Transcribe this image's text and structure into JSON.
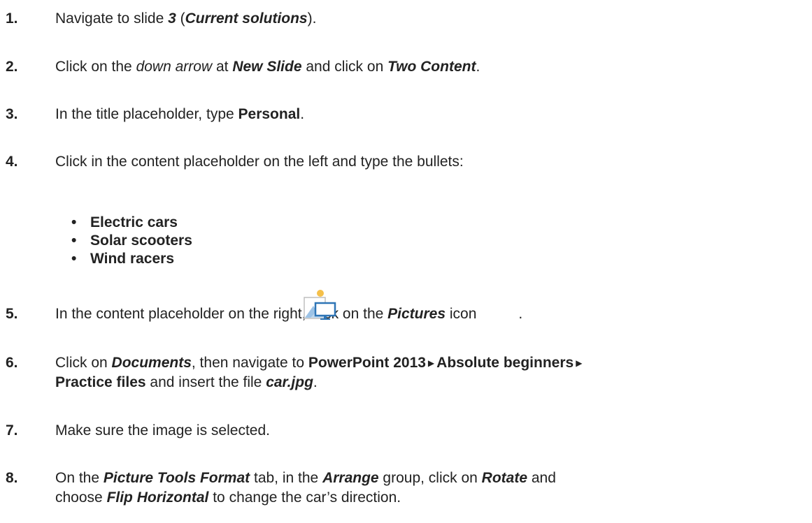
{
  "steps": [
    {
      "num": "1.",
      "a": "Navigate to slide ",
      "slide_no": "3",
      "b": " (",
      "slide_name": "Current solutions",
      "c": ")."
    },
    {
      "num": "2.",
      "a": "Click on the ",
      "em1": "down arrow",
      "b": " at ",
      "em2": "New Slide",
      "c": " and click on ",
      "em3": "Two Content",
      "d": "."
    },
    {
      "num": "3.",
      "a": "In the title placeholder, type ",
      "strong": "Personal",
      "b": "."
    },
    {
      "num": "4.",
      "a": "Click in the content placeholder on the left and type the bullets:"
    },
    {
      "num": "5.",
      "a": "In the content placeholder on the right, click on the ",
      "em": "Pictures",
      "b": " icon",
      "c": "."
    },
    {
      "num": "6.",
      "a": "Click on ",
      "em1": "Documents",
      "b": ", then navigate to ",
      "s1": "PowerPoint 2013",
      "s2": "Absolute beginners",
      "s3": "Practice files",
      "c": " and insert the file ",
      "em2": "car.jpg",
      "d": "."
    },
    {
      "num": "7.",
      "a": "Make sure the image is selected."
    },
    {
      "num": "8.",
      "a": "On the ",
      "em1": "Picture Tools Format",
      "b": " tab, in the ",
      "em2": "Arrange",
      "c": " group, click on ",
      "em3": "Rotate",
      "d": " and",
      "line2a": "choose ",
      "em4": "Flip Horizontal",
      "line2b": " to change the car’s direction."
    }
  ],
  "bullets": [
    "Electric cars",
    "Solar scooters",
    "Wind racers"
  ],
  "pictures_icon": {
    "name": "pictures-icon",
    "colors": {
      "frame": "#bfbfbf",
      "sun": "#f5c04a",
      "mountain": "#9dc3e6",
      "monitor": "#2e75b6"
    }
  }
}
